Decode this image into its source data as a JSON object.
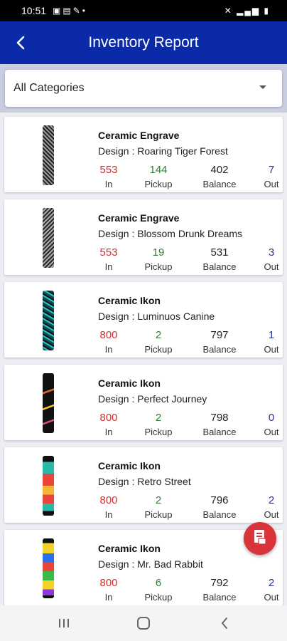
{
  "status_bar": {
    "time": "10:51"
  },
  "app_bar": {
    "title": "Inventory Report"
  },
  "filter": {
    "selected": "All Categories"
  },
  "labels": {
    "in": "In",
    "pickup": "Pickup",
    "balance": "Balance",
    "out": "Out"
  },
  "colors": {
    "primary": "#0a2aa8",
    "in": "#d32f2f",
    "pickup": "#2e7d32",
    "out": "#283593",
    "fab": "#d8343a"
  },
  "items": [
    {
      "name": "Ceramic Engrave",
      "design": "Design : Roaring Tiger Forest",
      "in": "553",
      "pickup": "144",
      "balance": "402",
      "out": "7"
    },
    {
      "name": "Ceramic Engrave",
      "design": "Design : Blossom Drunk Dreams",
      "in": "553",
      "pickup": "19",
      "balance": "531",
      "out": "3"
    },
    {
      "name": "Ceramic Ikon",
      "design": "Design : Luminuos Canine",
      "in": "800",
      "pickup": "2",
      "balance": "797",
      "out": "1"
    },
    {
      "name": "Ceramic Ikon",
      "design": "Design : Perfect Journey",
      "in": "800",
      "pickup": "2",
      "balance": "798",
      "out": "0"
    },
    {
      "name": "Ceramic Ikon",
      "design": "Design : Retro Street",
      "in": "800",
      "pickup": "2",
      "balance": "796",
      "out": "2"
    },
    {
      "name": "Ceramic Ikon",
      "design": "Design : Mr. Bad Rabbit",
      "in": "800",
      "pickup": "6",
      "balance": "792",
      "out": "2"
    }
  ],
  "icons": {
    "back": "back-arrow-icon",
    "dropdown": "caret-down-icon",
    "fab": "pdf-export-icon",
    "nav": [
      "recents-icon",
      "home-icon",
      "nav-back-icon"
    ]
  }
}
